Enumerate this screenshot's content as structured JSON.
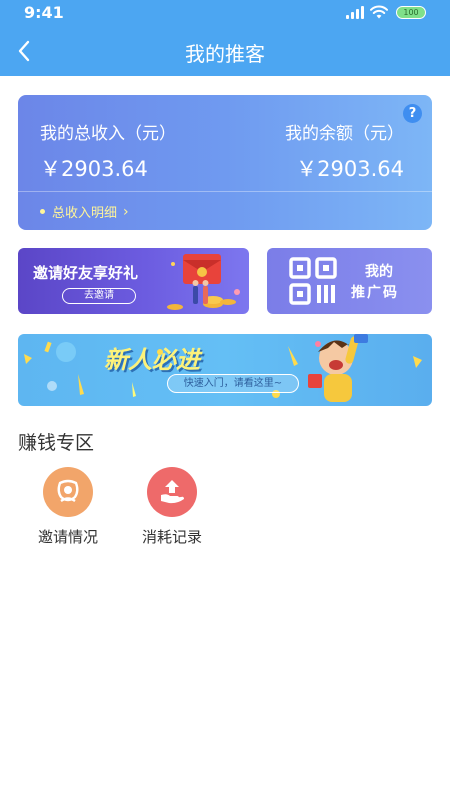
{
  "status_bar": {
    "time": "9:41",
    "battery": "100"
  },
  "nav": {
    "title": "我的推客"
  },
  "income_card": {
    "total_income_label": "我的总收入（元）",
    "total_income_value": "￥2903.64",
    "balance_label": "我的余额（元）",
    "balance_value": "￥2903.64",
    "detail_link": "总收入明细",
    "help": "?"
  },
  "invite_banner": {
    "title": "邀请好友享好礼",
    "button": "去邀请"
  },
  "promo_card": {
    "line1": "我的",
    "line2": "推广码"
  },
  "newbie_banner": {
    "title": "新人必进",
    "subtitle": "快速入门，请看这里~"
  },
  "section": {
    "title": "赚钱专区",
    "items": [
      {
        "label": "邀请情况",
        "icon": "invite-status-icon",
        "color": "#f2a56a"
      },
      {
        "label": "消耗记录",
        "icon": "consumption-record-icon",
        "color": "#ee6a6a"
      }
    ]
  },
  "colors": {
    "primary": "#4ca6f2",
    "card_gradient_start": "#6c86e8",
    "card_gradient_end": "#7db6f6",
    "detail_link": "#fff59a"
  }
}
